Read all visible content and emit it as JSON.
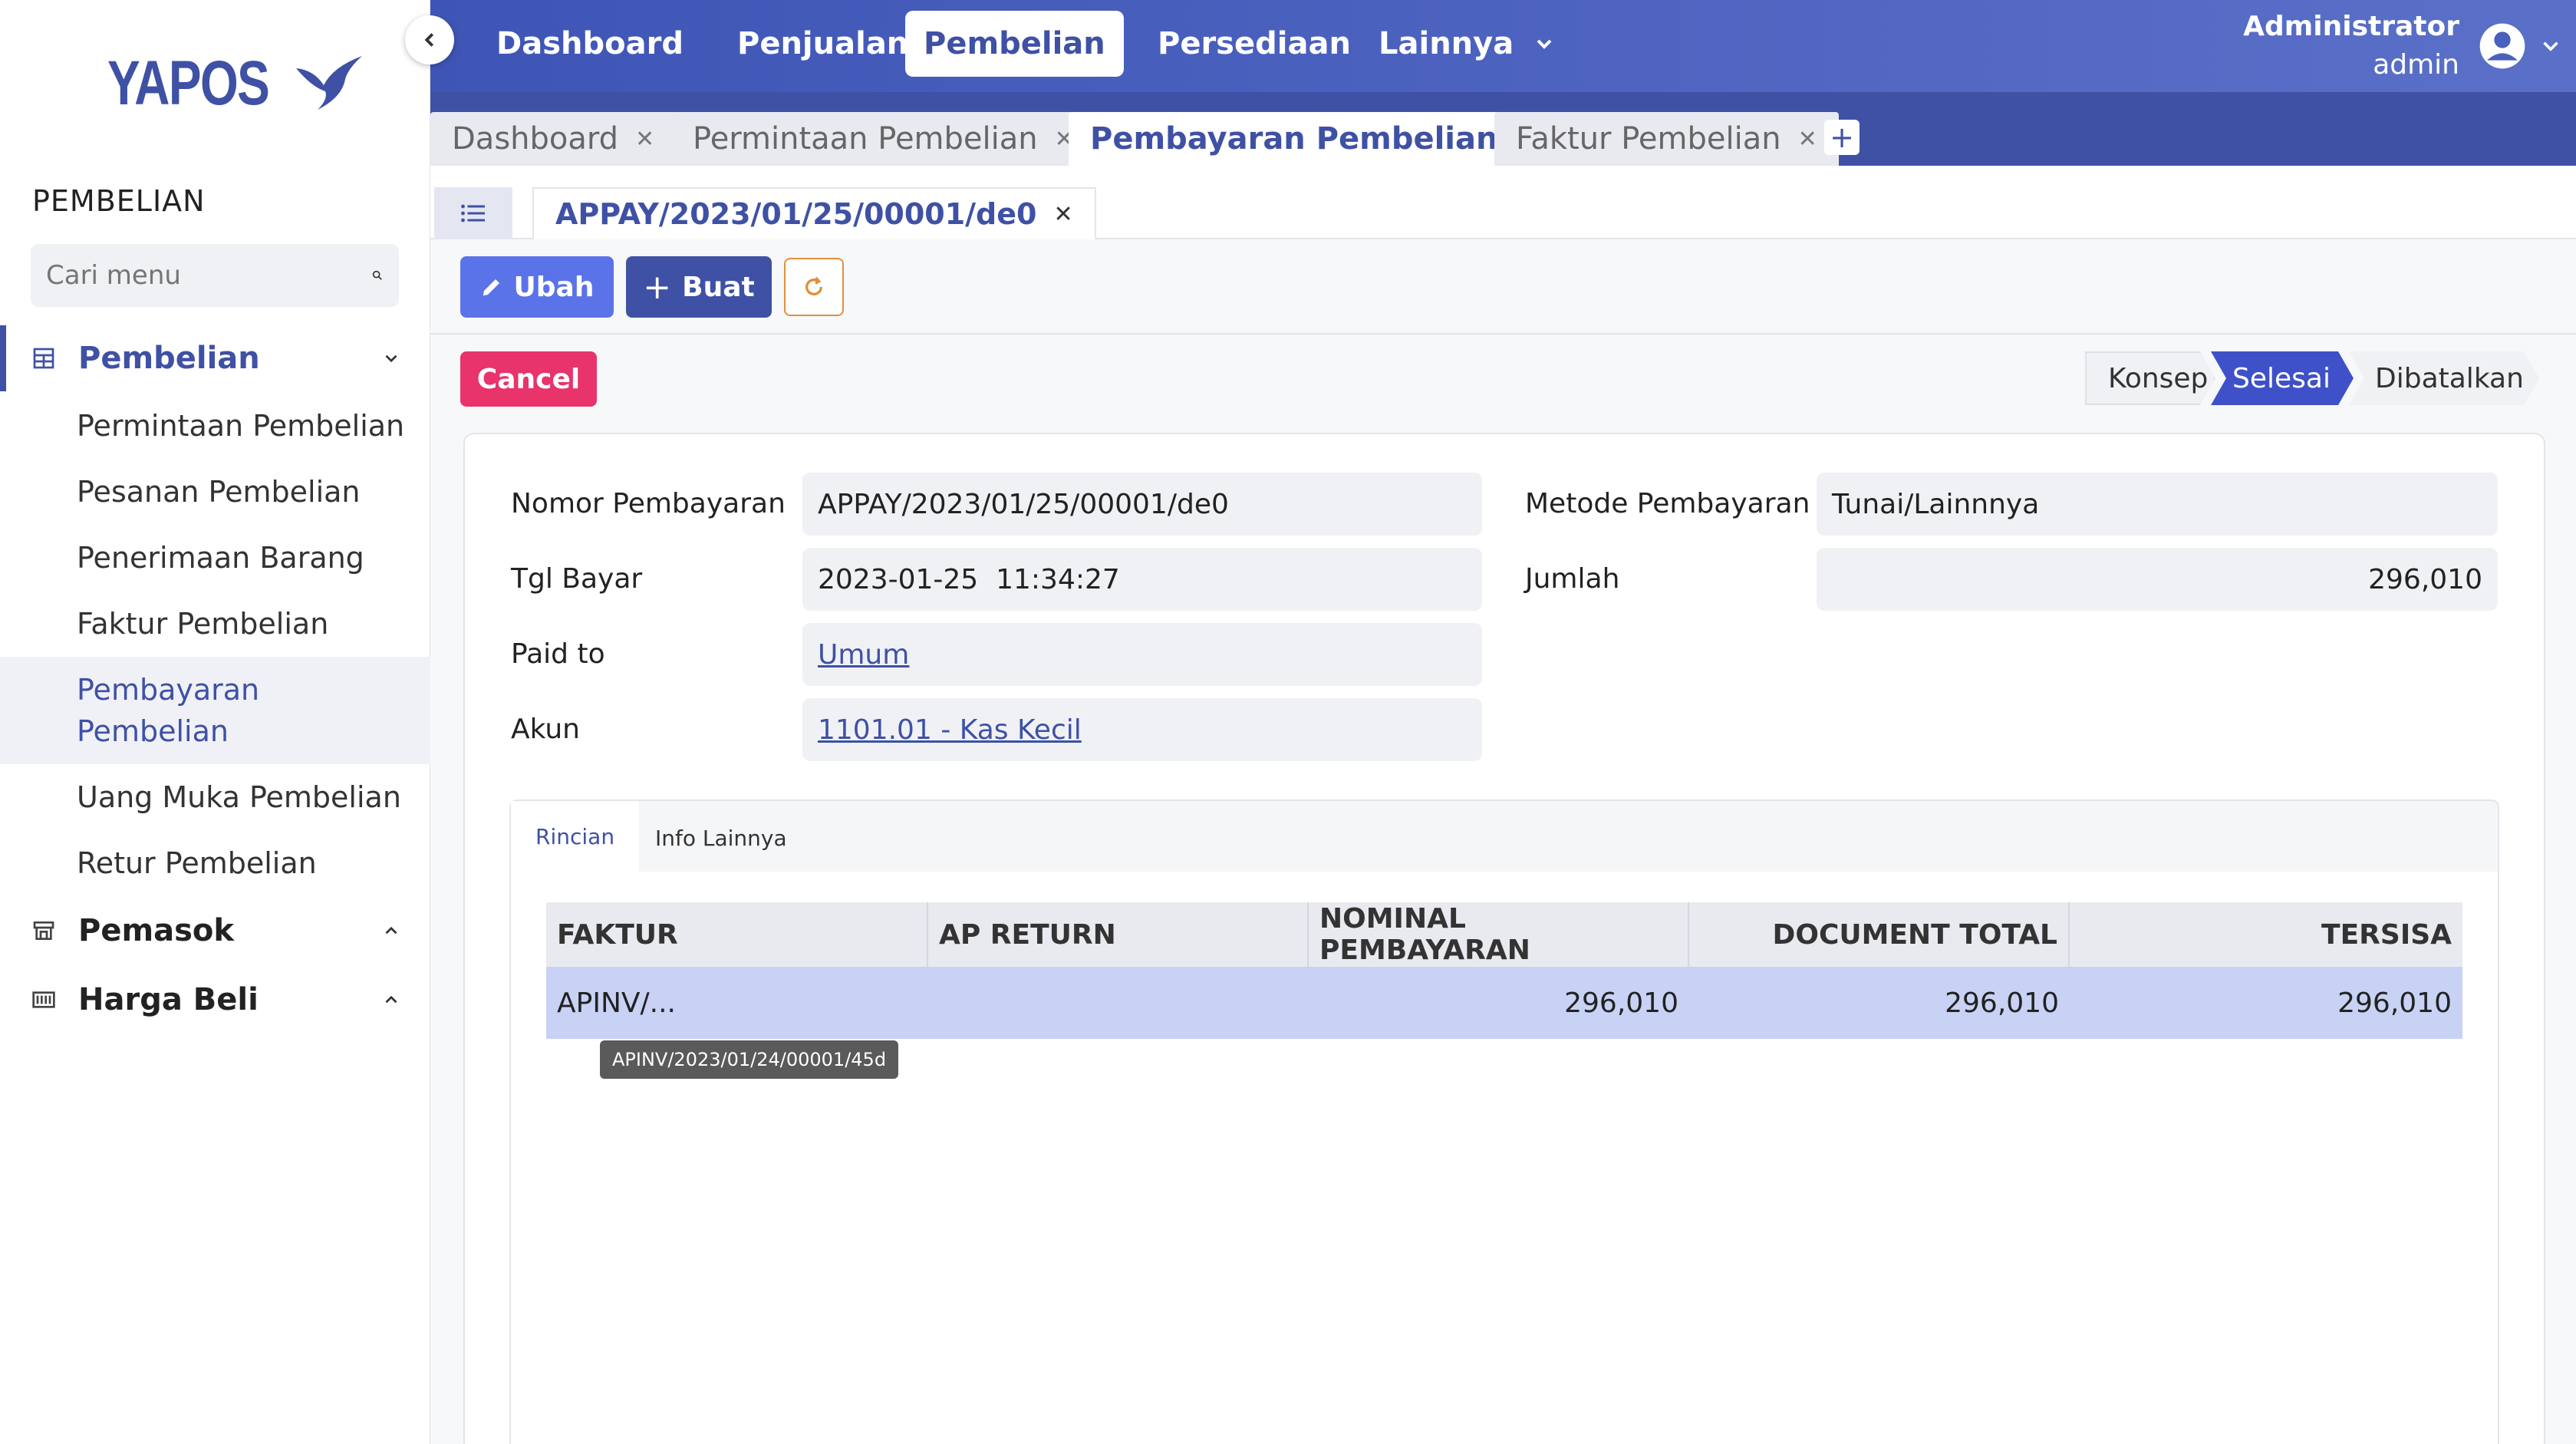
{
  "app": {
    "logo_text": "YAPOS"
  },
  "sidebar": {
    "section_title": "PEMBELIAN",
    "search_placeholder": "Cari menu",
    "groups": [
      {
        "label": "Pembelian",
        "icon": "table-icon",
        "expanded": true
      },
      {
        "label": "Pemasok",
        "icon": "store-icon",
        "expanded": false
      },
      {
        "label": "Harga Beli",
        "icon": "barcode-icon",
        "expanded": false
      }
    ],
    "items": [
      {
        "label": "Permintaan Pembelian"
      },
      {
        "label": "Pesanan Pembelian"
      },
      {
        "label": "Penerimaan Barang"
      },
      {
        "label": "Faktur Pembelian"
      },
      {
        "label": "Pembayaran Pembelian",
        "active": true
      },
      {
        "label": "Uang Muka Pembelian"
      },
      {
        "label": "Retur Pembelian"
      }
    ]
  },
  "topnav": {
    "items": [
      "Dashboard",
      "Penjualan",
      "Pembelian",
      "Persediaan",
      "Lainnya"
    ],
    "active": "Pembelian",
    "user_name": "Administrator",
    "user_role": "admin"
  },
  "tabs": [
    {
      "label": "Dashboard"
    },
    {
      "label": "Permintaan Pembelian"
    },
    {
      "label": "Pembayaran Pembelian",
      "active": true
    },
    {
      "label": "Faktur Pembelian"
    }
  ],
  "doc_tab": {
    "label": "APPAY/2023/01/25/00001/de0"
  },
  "toolbar": {
    "edit_label": "Ubah",
    "create_label": "Buat",
    "cancel_label": "Cancel"
  },
  "status_steps": [
    {
      "label": "Konsep"
    },
    {
      "label": "Selesai",
      "active": true
    },
    {
      "label": "Dibatalkan"
    }
  ],
  "form": {
    "nomor_label": "Nomor Pembayaran",
    "nomor_value": "APPAY/2023/01/25/00001/de0",
    "tgl_label": "Tgl Bayar",
    "tgl_value": "2023-01-25  11:34:27",
    "paid_label": "Paid to",
    "paid_value": "Umum",
    "akun_label": "Akun",
    "akun_value": "1101.01 - Kas Kecil",
    "metode_label": "Metode Pembayaran",
    "metode_value": "Tunai/Lainnnya",
    "jumlah_label": "Jumlah",
    "jumlah_value": "296,010"
  },
  "inner_tabs": [
    "Rincian",
    "Info Lainnya"
  ],
  "table": {
    "columns": [
      "FAKTUR",
      "AP RETURN",
      "NOMINAL PEMBAYARAN",
      "DOCUMENT TOTAL",
      "TERSISA"
    ],
    "rows": [
      {
        "faktur": "APINV/...",
        "ap_return": "",
        "nominal": "296,010",
        "total": "296,010",
        "tersisa": "296,010"
      }
    ],
    "tooltip": "APINV/2023/01/24/00001/45d"
  },
  "colors": {
    "primary": "#3f51a5",
    "accent_button": "#5b73e8",
    "cancel": "#e8336b",
    "row_selected": "#c8d2f4"
  }
}
